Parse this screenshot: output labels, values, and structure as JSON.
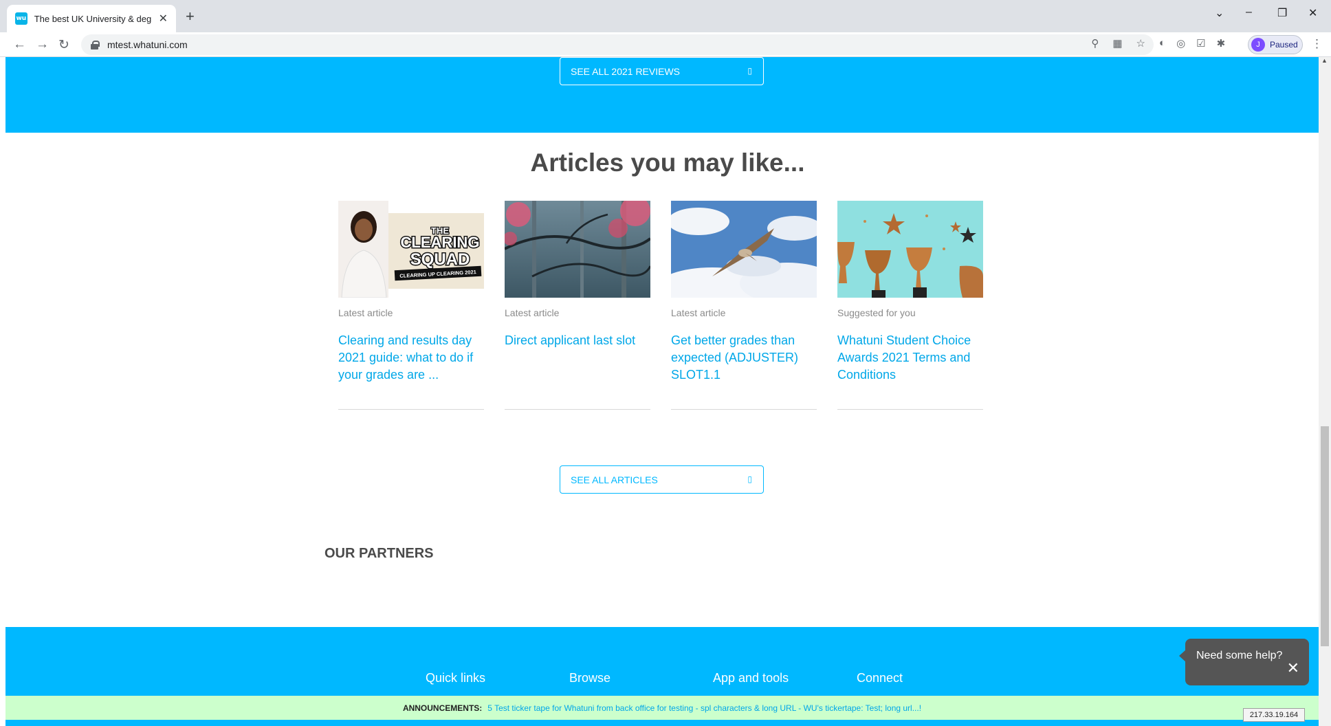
{
  "browser": {
    "tab_title": "The best UK University & degree",
    "favicon_text": "wu",
    "url": "mtest.whatuni.com",
    "profile_initial": "J",
    "profile_status": "Paused"
  },
  "page": {
    "reviews_button": "SEE ALL 2021 REVIEWS",
    "articles_heading": "Articles you may like...",
    "articles": [
      {
        "category": "Latest article",
        "title": "Clearing and results day 2021 guide: what to do if your grades are ...",
        "image": "clearing-squad"
      },
      {
        "category": "Latest article",
        "title": "Direct applicant last slot",
        "image": "misty-forest"
      },
      {
        "category": "Latest article",
        "title": "Get better grades than expected (ADJUSTER) SLOT1.1",
        "image": "hawk-sky"
      },
      {
        "category": "Suggested for you",
        "title": "Whatuni Student Choice Awards 2021 Terms and Conditions",
        "image": "trophies"
      }
    ],
    "clearing_img": {
      "line1": "THE",
      "line2": "CLEARING",
      "line3": "SQUAD",
      "line4": "CLEARING UP CLEARING 2021"
    },
    "all_articles_button": "SEE ALL ARTICLES",
    "partners_heading": "OUR PARTNERS",
    "footer_links": [
      "Quick links",
      "Browse",
      "App and tools",
      "Connect"
    ],
    "announcement_label": "ANNOUNCEMENTS:",
    "announcement_text": "5 Test ticker tape for Whatuni from back office for testing - spl characters & long URL - WU's tickertape: Test; long url...!",
    "help_bubble": "Need some help?",
    "ip_address": "217.33.19.164"
  },
  "colors": {
    "brand": "#00b8ff",
    "link": "#00a7e8",
    "ticker_bg": "#ccffcc"
  }
}
